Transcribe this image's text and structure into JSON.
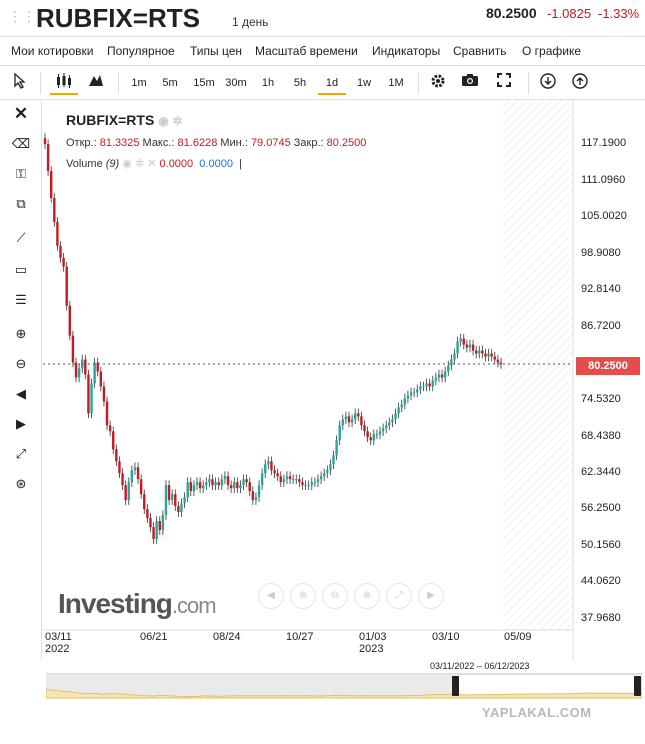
{
  "header": {
    "symbol": "RUBFIX=RTS",
    "period": "1 день",
    "price": "80.2500",
    "change": "-1.0825",
    "change_pct": "-1.33%"
  },
  "menu": [
    "Мои котировки",
    "Популярное",
    "Типы цен",
    "Масштаб времени",
    "Индикаторы",
    "Сравнить",
    "О графике"
  ],
  "toolbar": {
    "intervals": [
      "1m",
      "5m",
      "15m",
      "30m",
      "1h",
      "5h",
      "1d",
      "1w",
      "1M"
    ],
    "active_interval": "1d"
  },
  "legend": {
    "symbol": "RUBFIX=RTS",
    "open_label": "Откр.:",
    "open": "81.3325",
    "high_label": "Макс.:",
    "high": "81.6228",
    "low_label": "Мин.:",
    "low": "79.0745",
    "close_label": "Закр.:",
    "close": "80.2500",
    "volume_label": "Volume",
    "volume_param": "(9)",
    "volume_val1": "0.0000",
    "volume_val2": "0.0000"
  },
  "yaxis": [
    "117.1900",
    "111.0960",
    "105.0020",
    "98.9080",
    "92.8140",
    "86.7200",
    "74.5320",
    "68.4380",
    "62.3440",
    "56.2500",
    "50.1560",
    "44.0620",
    "37.9680"
  ],
  "last_price_tag": "80.2500",
  "xaxis": [
    {
      "label": "03/11",
      "sub": "2022"
    },
    {
      "label": "06/21",
      "sub": ""
    },
    {
      "label": "08/24",
      "sub": ""
    },
    {
      "label": "10/27",
      "sub": ""
    },
    {
      "label": "01/03",
      "sub": "2023"
    },
    {
      "label": "03/10",
      "sub": ""
    },
    {
      "label": "05/09",
      "sub": ""
    }
  ],
  "navigator_range": "03/11/2022 – 06/12/2023",
  "logo": {
    "main": "Investing",
    "suffix": ".com"
  },
  "watermark": "YAPLAKAL.COM",
  "colors": {
    "up": "#26a69a",
    "down": "#c7191f",
    "accent": "#f0a500",
    "tag": "#e54d4d"
  },
  "chart_data": {
    "type": "candlestick",
    "ylim": [
      37.968,
      120.0
    ],
    "x": [
      "03/11/2022",
      "03/14",
      "03/16",
      "03/18",
      "03/21",
      "03/23",
      "03/25",
      "03/29",
      "03/31",
      "04/04",
      "04/06",
      "04/08",
      "04/12",
      "04/14",
      "04/18",
      "04/20",
      "04/22",
      "04/26",
      "04/28",
      "05/04",
      "05/06",
      "05/12",
      "05/16",
      "05/18",
      "05/20",
      "05/24",
      "05/26",
      "05/30",
      "06/01",
      "06/03",
      "06/07",
      "06/09",
      "06/14",
      "06/16",
      "06/20",
      "06/22",
      "06/24",
      "06/28",
      "06/30",
      "07/04",
      "07/06",
      "07/08",
      "07/12",
      "07/14",
      "07/18",
      "07/20",
      "07/22",
      "07/26",
      "07/28",
      "08/01",
      "08/03",
      "08/05",
      "08/09",
      "08/11",
      "08/15",
      "08/17",
      "08/19",
      "08/23",
      "08/25",
      "08/29",
      "08/31",
      "09/02",
      "09/06",
      "09/08",
      "09/12",
      "09/14",
      "09/16",
      "09/20",
      "09/22",
      "09/26",
      "09/28",
      "09/30",
      "10/04",
      "10/06",
      "10/10",
      "10/12",
      "10/14",
      "10/18",
      "10/20",
      "10/24",
      "10/26",
      "10/28",
      "11/01",
      "11/03",
      "11/08",
      "11/10",
      "11/14",
      "11/16",
      "11/18",
      "11/22",
      "11/24",
      "11/28",
      "11/30",
      "12/02",
      "12/06",
      "12/08",
      "12/12",
      "12/14",
      "12/16",
      "12/20",
      "12/22",
      "12/26",
      "12/28",
      "01/03/2023",
      "01/10",
      "01/12",
      "01/16",
      "01/18",
      "01/20",
      "01/24",
      "01/26",
      "01/30",
      "02/01",
      "02/03",
      "02/07",
      "02/09",
      "02/13",
      "02/15",
      "02/17",
      "02/21",
      "02/24",
      "02/28",
      "03/02",
      "03/06",
      "03/10",
      "03/14",
      "03/16",
      "03/20",
      "03/22",
      "03/24",
      "03/28",
      "03/30",
      "04/03",
      "04/05",
      "04/07",
      "04/11",
      "04/13",
      "04/17",
      "04/19",
      "04/21",
      "04/25",
      "04/27",
      "05/03",
      "05/05",
      "05/11",
      "05/15",
      "05/17",
      "05/19",
      "05/23",
      "05/25",
      "05/29",
      "05/31",
      "06/02",
      "06/06",
      "06/08",
      "06/12"
    ],
    "close": [
      117.0,
      112.5,
      108.0,
      104.0,
      100.0,
      98.0,
      96.5,
      90.0,
      85.0,
      80.5,
      78.0,
      79.5,
      81.0,
      78.5,
      72.0,
      77.0,
      80.5,
      79.0,
      76.5,
      74.0,
      70.0,
      69.0,
      66.0,
      64.0,
      62.0,
      60.0,
      57.5,
      60.5,
      62.5,
      63.0,
      61.0,
      58.5,
      56.0,
      54.5,
      53.0,
      51.0,
      54.0,
      52.5,
      55.0,
      60.0,
      57.5,
      58.5,
      56.5,
      55.5,
      57.0,
      58.0,
      60.5,
      59.0,
      60.0,
      60.5,
      59.5,
      60.0,
      60.5,
      61.0,
      60.0,
      60.5,
      60.0,
      61.0,
      61.5,
      60.0,
      59.5,
      60.5,
      59.5,
      60.0,
      61.0,
      60.5,
      59.0,
      57.5,
      58.0,
      60.0,
      62.0,
      63.5,
      64.0,
      62.5,
      62.0,
      61.5,
      60.5,
      61.0,
      61.5,
      61.0,
      61.0,
      61.0,
      60.5,
      60.0,
      60.0,
      60.0,
      60.5,
      60.5,
      61.0,
      61.5,
      62.0,
      62.5,
      63.5,
      65.0,
      67.5,
      70.0,
      71.0,
      71.5,
      70.5,
      71.0,
      72.0,
      71.5,
      70.0,
      69.0,
      68.0,
      67.5,
      68.5,
      68.5,
      69.0,
      69.5,
      70.0,
      70.5,
      71.0,
      72.0,
      73.0,
      73.5,
      74.5,
      75.0,
      75.5,
      75.5,
      76.0,
      76.5,
      76.5,
      77.0,
      76.5,
      77.5,
      78.0,
      78.5,
      78.0,
      79.0,
      80.0,
      81.0,
      82.0,
      84.0,
      84.5,
      83.5,
      83.0,
      83.5,
      82.5,
      82.0,
      82.5,
      82.0,
      81.5,
      82.0,
      81.5,
      81.0,
      80.5,
      80.25
    ]
  }
}
